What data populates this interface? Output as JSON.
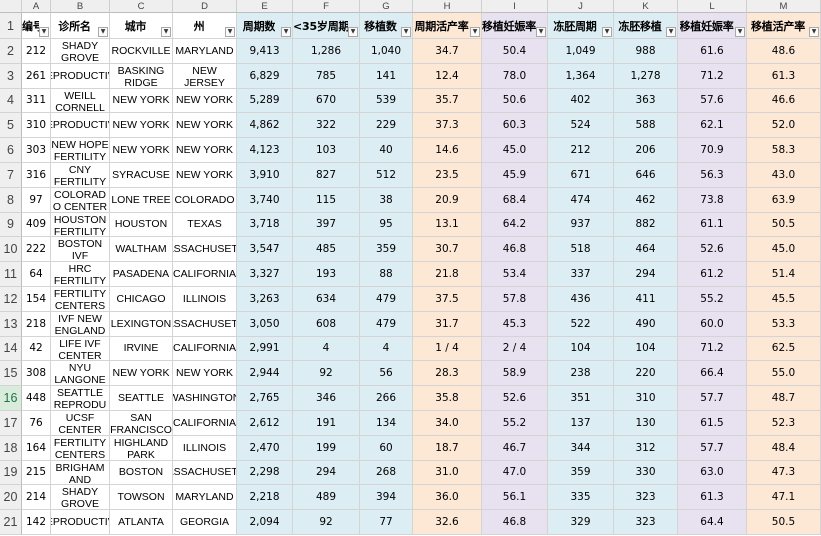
{
  "columns": [
    {
      "letter": "A",
      "header": "编号",
      "bg": "#ffffff"
    },
    {
      "letter": "B",
      "header": "诊所名",
      "bg": "#ffffff"
    },
    {
      "letter": "C",
      "header": "城市",
      "bg": "#ffffff"
    },
    {
      "letter": "D",
      "header": "州",
      "bg": "#ffffff"
    },
    {
      "letter": "E",
      "header": "周期数",
      "bg": "#dcedf3"
    },
    {
      "letter": "F",
      "header": "<35岁周期",
      "bg": "#dcedf3"
    },
    {
      "letter": "G",
      "header": "移植数",
      "bg": "#dcedf3"
    },
    {
      "letter": "H",
      "header": "周期活产率",
      "bg": "#fde7d5"
    },
    {
      "letter": "I",
      "header": "移植妊娠率",
      "bg": "#e7e1f0"
    },
    {
      "letter": "J",
      "header": "冻胚周期",
      "bg": "#dcedf3"
    },
    {
      "letter": "K",
      "header": "冻胚移植",
      "bg": "#dcedf3"
    },
    {
      "letter": "L",
      "header": "移植妊娠率",
      "bg": "#e7e1f0"
    },
    {
      "letter": "M",
      "header": "移植活产率",
      "bg": "#fde7d5"
    }
  ],
  "header_row_number": "1",
  "active_row": "16",
  "filter_icon": "filter-dropdown-icon",
  "rows": [
    {
      "n": "2",
      "cells": [
        "212",
        "SHADY GROVE",
        "ROCKVILLE",
        "MARYLAND",
        "9,413",
        "1,286",
        "1,040",
        "34.7",
        "50.4",
        "1,049",
        "988",
        "61.6",
        "48.6"
      ]
    },
    {
      "n": "3",
      "cells": [
        "261",
        "REPRODUCTIVE",
        "BASKING RIDGE",
        "NEW JERSEY",
        "6,829",
        "785",
        "141",
        "12.4",
        "78.0",
        "1,364",
        "1,278",
        "71.2",
        "61.3"
      ]
    },
    {
      "n": "4",
      "cells": [
        "311",
        "WEILL CORNELL",
        "NEW YORK",
        "NEW YORK",
        "5,289",
        "670",
        "539",
        "35.7",
        "50.6",
        "402",
        "363",
        "57.6",
        "46.6"
      ]
    },
    {
      "n": "5",
      "cells": [
        "310",
        "REPRODUCTIVE",
        "NEW YORK",
        "NEW YORK",
        "4,862",
        "322",
        "229",
        "37.3",
        "60.3",
        "524",
        "588",
        "62.1",
        "52.0"
      ]
    },
    {
      "n": "6",
      "cells": [
        "303",
        "NEW HOPE FERTILITY",
        "NEW YORK",
        "NEW YORK",
        "4,123",
        "103",
        "40",
        "14.6",
        "45.0",
        "212",
        "206",
        "70.9",
        "58.3"
      ]
    },
    {
      "n": "7",
      "cells": [
        "316",
        "CNY FERTILITY",
        "SYRACUSE",
        "NEW YORK",
        "3,910",
        "827",
        "512",
        "23.5",
        "45.9",
        "671",
        "646",
        "56.3",
        "43.0"
      ]
    },
    {
      "n": "8",
      "cells": [
        "97",
        "COLORADO CENTER",
        "LONE TREE",
        "COLORADO",
        "3,740",
        "115",
        "38",
        "20.9",
        "68.4",
        "474",
        "462",
        "73.8",
        "63.9"
      ]
    },
    {
      "n": "9",
      "cells": [
        "409",
        "HOUSTON FERTILITY",
        "HOUSTON",
        "TEXAS",
        "3,718",
        "397",
        "95",
        "13.1",
        "64.2",
        "937",
        "882",
        "61.1",
        "50.5"
      ]
    },
    {
      "n": "10",
      "cells": [
        "222",
        "BOSTON IVF",
        "WALTHAM",
        "MASSACHUSETTS",
        "3,547",
        "485",
        "359",
        "30.7",
        "46.8",
        "518",
        "464",
        "52.6",
        "45.0"
      ]
    },
    {
      "n": "11",
      "cells": [
        "64",
        "HRC FERTILITY",
        "PASADENA",
        "CALIFORNIA",
        "3,327",
        "193",
        "88",
        "21.8",
        "53.4",
        "337",
        "294",
        "61.2",
        "51.4"
      ]
    },
    {
      "n": "12",
      "cells": [
        "154",
        "FERTILITY CENTERS",
        "CHICAGO",
        "ILLINOIS",
        "3,263",
        "634",
        "479",
        "37.5",
        "57.8",
        "436",
        "411",
        "55.2",
        "45.5"
      ]
    },
    {
      "n": "13",
      "cells": [
        "218",
        "IVF NEW ENGLAND",
        "LEXINGTON",
        "MASSACHUSETTS",
        "3,050",
        "608",
        "479",
        "31.7",
        "45.3",
        "522",
        "490",
        "60.0",
        "53.3"
      ]
    },
    {
      "n": "14",
      "cells": [
        "42",
        "LIFE IVF CENTER",
        "IRVINE",
        "CALIFORNIA",
        "2,991",
        "4",
        "4",
        "1 / 4",
        "2 / 4",
        "104",
        "104",
        "71.2",
        "62.5"
      ]
    },
    {
      "n": "15",
      "cells": [
        "308",
        "NYU LANGONE",
        "NEW YORK",
        "NEW YORK",
        "2,944",
        "92",
        "56",
        "28.3",
        "58.9",
        "238",
        "220",
        "66.4",
        "55.0"
      ]
    },
    {
      "n": "16",
      "cells": [
        "448",
        "SEATTLE REPRODUCTIVE",
        "SEATTLE",
        "WASHINGTON",
        "2,765",
        "346",
        "266",
        "35.8",
        "52.6",
        "351",
        "310",
        "57.7",
        "48.7"
      ]
    },
    {
      "n": "17",
      "cells": [
        "76",
        "UCSF CENTER",
        "SAN FRANCISCO",
        "CALIFORNIA",
        "2,612",
        "191",
        "134",
        "34.0",
        "55.2",
        "137",
        "130",
        "61.5",
        "52.3"
      ]
    },
    {
      "n": "18",
      "cells": [
        "164",
        "FERTILITY CENTERS",
        "HIGHLAND PARK",
        "ILLINOIS",
        "2,470",
        "199",
        "60",
        "18.7",
        "46.7",
        "344",
        "312",
        "57.7",
        "48.4"
      ]
    },
    {
      "n": "19",
      "cells": [
        "215",
        "BRIGHAM AND",
        "BOSTON",
        "MASSACHUSETTS",
        "2,298",
        "294",
        "268",
        "31.0",
        "47.0",
        "359",
        "330",
        "63.0",
        "47.3"
      ]
    },
    {
      "n": "20",
      "cells": [
        "214",
        "SHADY GROVE",
        "TOWSON",
        "MARYLAND",
        "2,218",
        "489",
        "394",
        "36.0",
        "56.1",
        "335",
        "323",
        "61.3",
        "47.1"
      ]
    },
    {
      "n": "21",
      "cells": [
        "142",
        "REPRODUCTIVE",
        "ATLANTA",
        "GEORGIA",
        "2,094",
        "92",
        "77",
        "32.6",
        "46.8",
        "329",
        "323",
        "64.4",
        "50.5"
      ]
    }
  ]
}
